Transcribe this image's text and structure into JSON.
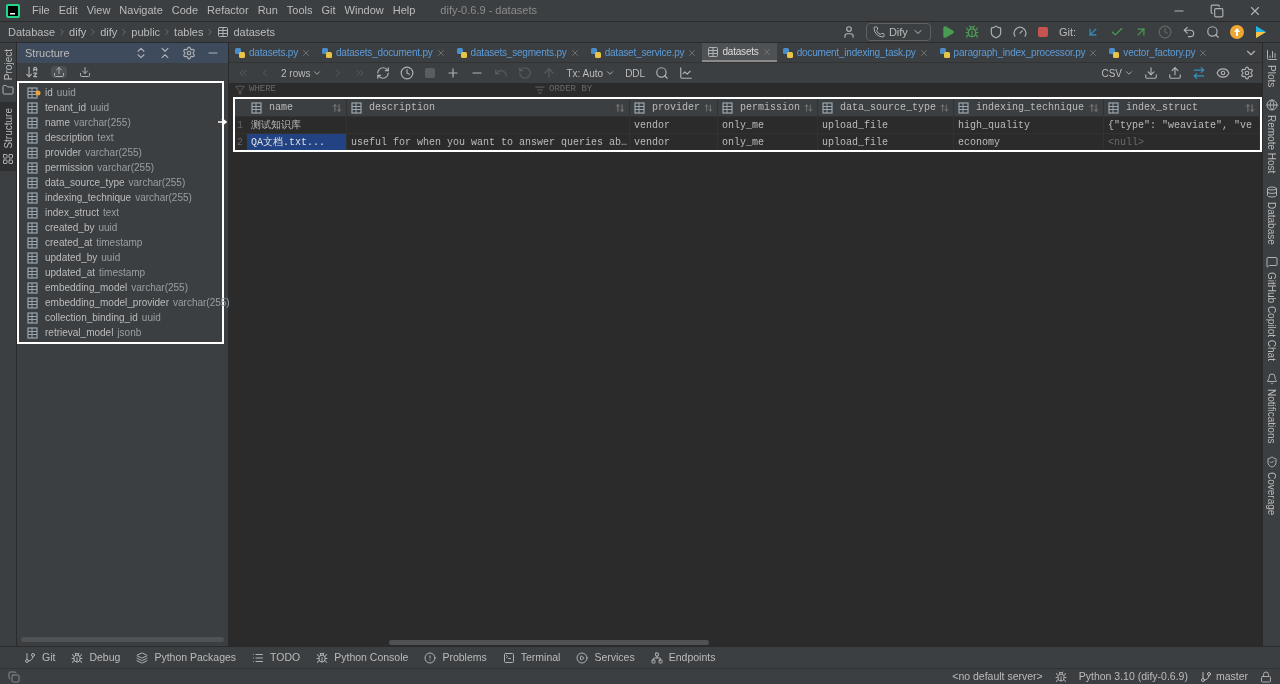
{
  "window": {
    "title": "dify-0.6.9 - datasets"
  },
  "menu": [
    "File",
    "Edit",
    "View",
    "Navigate",
    "Code",
    "Refactor",
    "Run",
    "Tools",
    "Git",
    "Window",
    "Help"
  ],
  "breadcrumb": [
    "Database",
    "dify",
    "dify",
    "public",
    "tables",
    "datasets"
  ],
  "toolbar": {
    "run_config": "Dify",
    "git_label": "Git:"
  },
  "left_strip": [
    {
      "label": "Project",
      "selected": false
    },
    {
      "label": "Structure",
      "selected": true
    }
  ],
  "right_strip": [
    "Plots",
    "Remote Host",
    "Database",
    "GitHub Copilot Chat",
    "Notifications",
    "Coverage"
  ],
  "structure": {
    "title": "Structure",
    "columns": [
      {
        "name": "id",
        "type": "uuid",
        "primary_key": true
      },
      {
        "name": "tenant_id",
        "type": "uuid",
        "primary_key": false
      },
      {
        "name": "name",
        "type": "varchar(255)",
        "primary_key": false
      },
      {
        "name": "description",
        "type": "text",
        "primary_key": false
      },
      {
        "name": "provider",
        "type": "varchar(255)",
        "primary_key": false
      },
      {
        "name": "permission",
        "type": "varchar(255)",
        "primary_key": false
      },
      {
        "name": "data_source_type",
        "type": "varchar(255)",
        "primary_key": false
      },
      {
        "name": "indexing_technique",
        "type": "varchar(255)",
        "primary_key": false
      },
      {
        "name": "index_struct",
        "type": "text",
        "primary_key": false
      },
      {
        "name": "created_by",
        "type": "uuid",
        "primary_key": false
      },
      {
        "name": "created_at",
        "type": "timestamp",
        "primary_key": false
      },
      {
        "name": "updated_by",
        "type": "uuid",
        "primary_key": false
      },
      {
        "name": "updated_at",
        "type": "timestamp",
        "primary_key": false
      },
      {
        "name": "embedding_model",
        "type": "varchar(255)",
        "primary_key": false
      },
      {
        "name": "embedding_model_provider",
        "type": "varchar(255)",
        "primary_key": false
      },
      {
        "name": "collection_binding_id",
        "type": "uuid",
        "primary_key": false
      },
      {
        "name": "retrieval_model",
        "type": "jsonb",
        "primary_key": false
      }
    ]
  },
  "editor_tabs": [
    {
      "label": "datasets.py",
      "kind": "python",
      "selected": false
    },
    {
      "label": "datasets_document.py",
      "kind": "python",
      "selected": false
    },
    {
      "label": "datasets_segments.py",
      "kind": "python",
      "selected": false
    },
    {
      "label": "dataset_service.py",
      "kind": "python",
      "selected": false
    },
    {
      "label": "datasets",
      "kind": "table",
      "selected": true
    },
    {
      "label": "document_indexing_task.py",
      "kind": "python",
      "selected": false
    },
    {
      "label": "paragraph_index_processor.py",
      "kind": "python",
      "selected": false
    },
    {
      "label": "vector_factory.py",
      "kind": "python",
      "selected": false
    }
  ],
  "data_toolbar": {
    "rows": "2 rows",
    "tx": "Tx: Auto",
    "ddl": "DDL",
    "export": "CSV"
  },
  "filter": {
    "where": "WHERE",
    "order_by": "ORDER BY"
  },
  "table": {
    "columns": [
      "name",
      "description",
      "provider",
      "permission",
      "data_source_type",
      "indexing_technique",
      "index_struct"
    ],
    "rows": [
      {
        "number": "1",
        "cells": [
          {
            "text": "测试知识库",
            "kind": "value",
            "selected": false
          },
          {
            "text": "",
            "kind": "value",
            "selected": false
          },
          {
            "text": "vendor",
            "kind": "value",
            "selected": false
          },
          {
            "text": "only_me",
            "kind": "value",
            "selected": false
          },
          {
            "text": "upload_file",
            "kind": "value",
            "selected": false
          },
          {
            "text": "high_quality",
            "kind": "value",
            "selected": false
          },
          {
            "text": "{\"type\": \"weaviate\", \"ve",
            "kind": "value",
            "selected": false
          }
        ]
      },
      {
        "number": "2",
        "cells": [
          {
            "text": "QA文档.txt...",
            "kind": "value",
            "selected": true
          },
          {
            "text": "useful for when you want to answer queries ab…",
            "kind": "value",
            "selected": false
          },
          {
            "text": "vendor",
            "kind": "value",
            "selected": false
          },
          {
            "text": "only_me",
            "kind": "value",
            "selected": false
          },
          {
            "text": "upload_file",
            "kind": "value",
            "selected": false
          },
          {
            "text": "economy",
            "kind": "value",
            "selected": false
          },
          {
            "text": "<null>",
            "kind": "null",
            "selected": false
          }
        ]
      }
    ]
  },
  "tool_windows": [
    "Git",
    "Debug",
    "Python Packages",
    "TODO",
    "Python Console",
    "Problems",
    "Terminal",
    "Services",
    "Endpoints"
  ],
  "status_bar": {
    "server": "<no default server>",
    "interpreter": "Python 3.10 (dify-0.6.9)",
    "branch": "master"
  }
}
